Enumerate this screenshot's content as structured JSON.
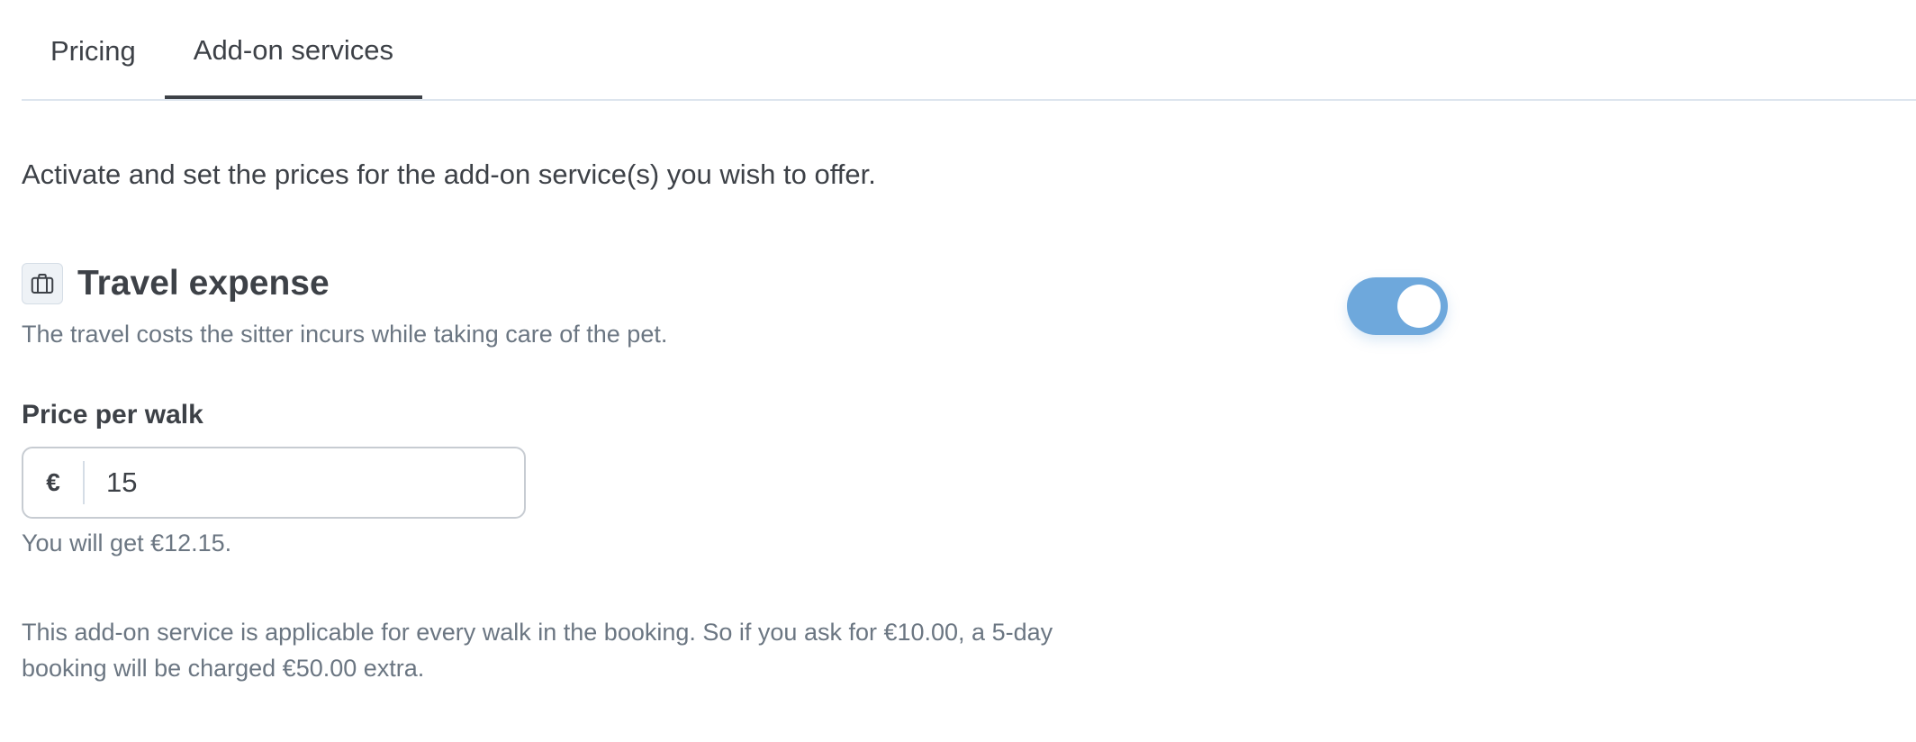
{
  "tabs": [
    {
      "label": "Pricing",
      "active": false
    },
    {
      "label": "Add-on services",
      "active": true
    }
  ],
  "intro_text": "Activate and set the prices for the add-on service(s) you wish to offer.",
  "service": {
    "icon": "briefcase-icon",
    "title": "Travel expense",
    "description": "The travel costs the sitter incurs while taking care of the pet.",
    "enabled": true
  },
  "price_field": {
    "label": "Price per walk",
    "currency_symbol": "€",
    "value": "15",
    "earnings_note": "You will get €12.15."
  },
  "info_note": "This add-on service is applicable for every walk in the booking. So if you ask for €10.00, a 5-day booking will be charged €50.00 extra.",
  "colors": {
    "toggle_on": "#6ea8dc",
    "text_primary": "#3d4147",
    "text_secondary": "#6b7682"
  }
}
